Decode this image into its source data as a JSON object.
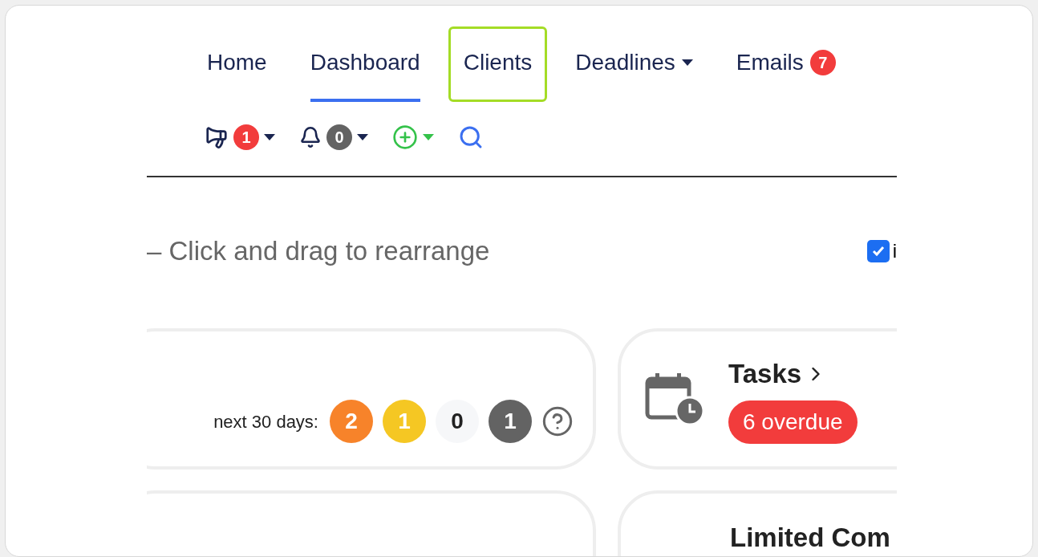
{
  "tabs": [
    {
      "label": "Home",
      "selected": false,
      "highlighted": false,
      "caret": false
    },
    {
      "label": "Dashboard",
      "selected": true,
      "highlighted": false,
      "caret": false
    },
    {
      "label": "Clients",
      "selected": false,
      "highlighted": true,
      "caret": false
    },
    {
      "label": "Deadlines",
      "selected": false,
      "highlighted": false,
      "caret": true
    },
    {
      "label": "Emails",
      "selected": false,
      "highlighted": false,
      "caret": false,
      "badge": "7"
    }
  ],
  "toolbar": [
    {
      "kind": "megaphone",
      "badge": "1",
      "color": "#f23c3c"
    },
    {
      "kind": "bell",
      "badge": "0",
      "color": "#636363"
    },
    {
      "kind": "add"
    },
    {
      "kind": "search"
    }
  ],
  "hint": "– Click and drag to rearrange",
  "option": {
    "label": "i",
    "checked": true
  },
  "deadlines_card": {
    "label": "next 30 days:",
    "counts": [
      {
        "value": "2",
        "color": "#f7832a"
      },
      {
        "value": "1",
        "color": "#f5c723"
      },
      {
        "value": "0",
        "color": "#f6f7f9"
      },
      {
        "value": "1",
        "color": "#636363"
      }
    ]
  },
  "tasks_card": {
    "title": "Tasks",
    "overdue": "6 overdue"
  },
  "lower_card": {
    "title": "Limited Com"
  }
}
